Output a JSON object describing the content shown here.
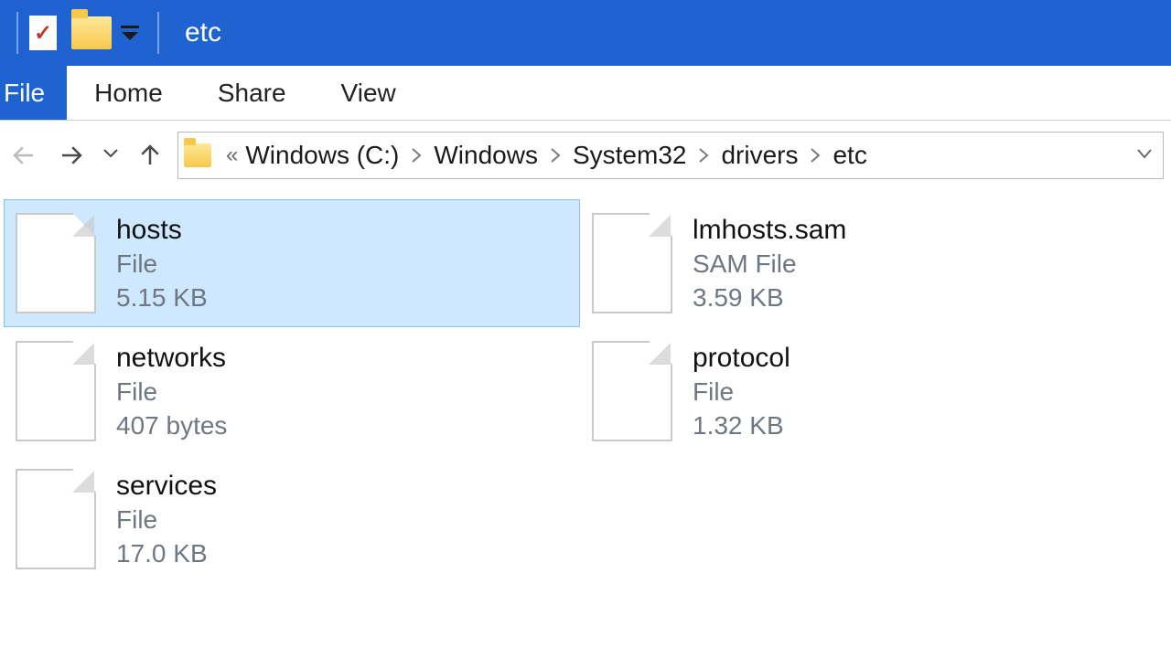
{
  "window": {
    "title": "etc"
  },
  "ribbon": {
    "file": "File",
    "home": "Home",
    "share": "Share",
    "view": "View"
  },
  "breadcrumb": {
    "overflow": "«",
    "segments": [
      "Windows (C:)",
      "Windows",
      "System32",
      "drivers",
      "etc"
    ]
  },
  "files": [
    {
      "name": "hosts",
      "type": "File",
      "size": "5.15 KB",
      "selected": true
    },
    {
      "name": "lmhosts.sam",
      "type": "SAM File",
      "size": "3.59 KB",
      "selected": false
    },
    {
      "name": "networks",
      "type": "File",
      "size": "407 bytes",
      "selected": false
    },
    {
      "name": "protocol",
      "type": "File",
      "size": "1.32 KB",
      "selected": false
    },
    {
      "name": "services",
      "type": "File",
      "size": "17.0 KB",
      "selected": false
    }
  ]
}
